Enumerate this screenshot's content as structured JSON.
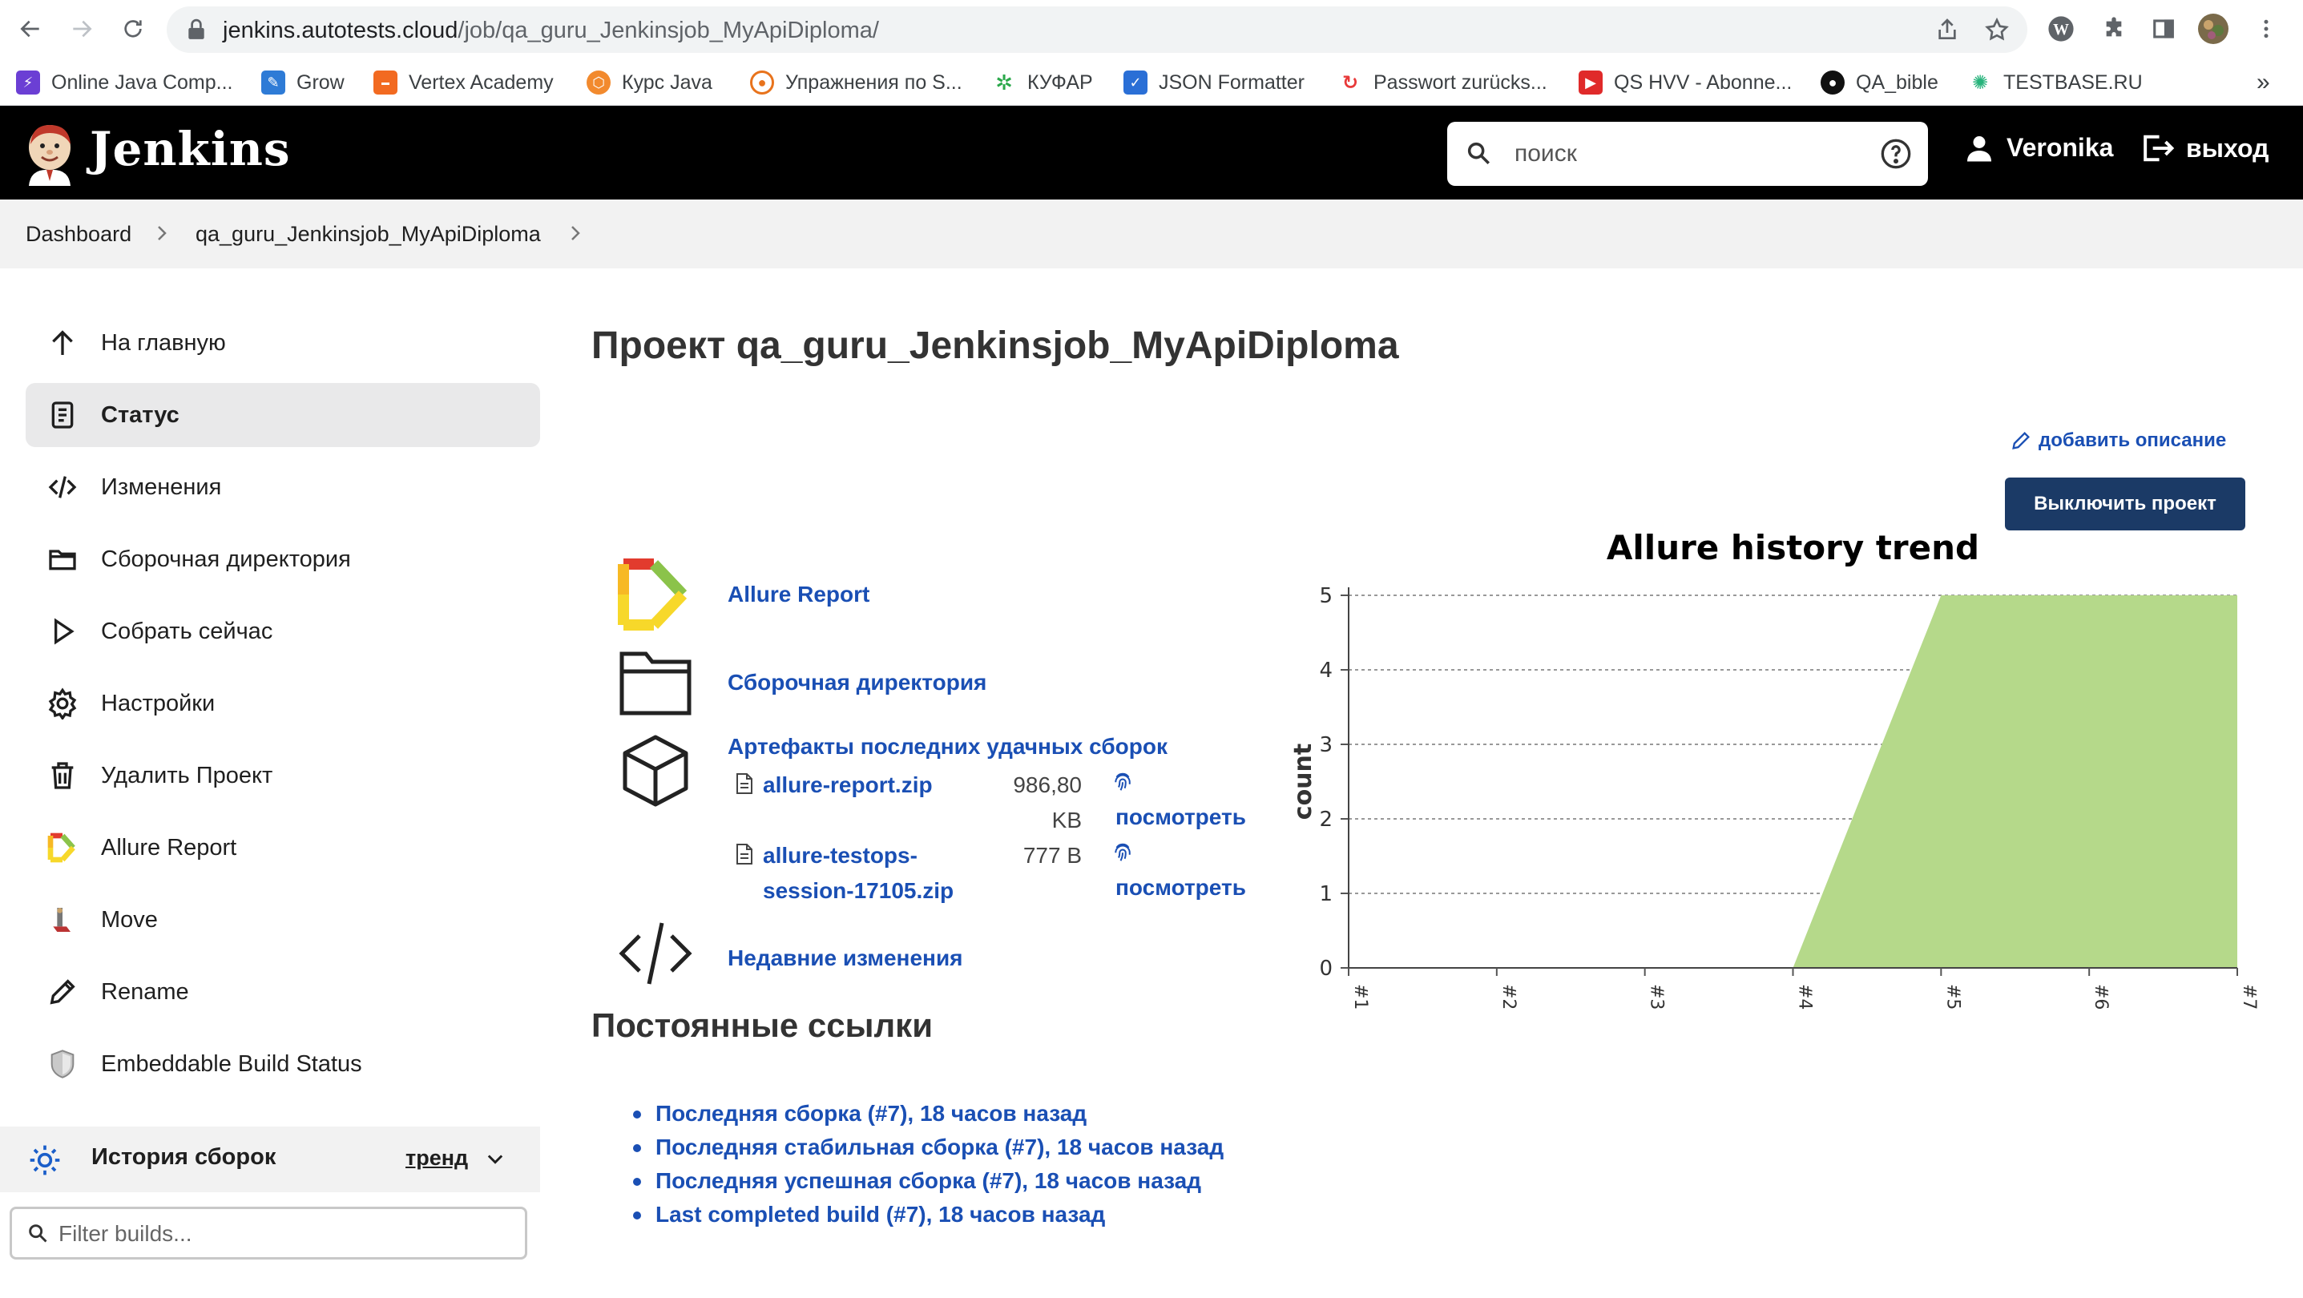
{
  "browser": {
    "url_host": "jenkins.autotests.cloud",
    "url_path": "/job/qa_guru_Jenkinsjob_MyApiDiploma/",
    "bookmarks": [
      {
        "label": "Online Java Comp...",
        "icon": "lightning-icon",
        "color": "#6b3fd4"
      },
      {
        "label": "Grow",
        "icon": "grow-icon",
        "color": "#2e7bd6"
      },
      {
        "label": "Vertex Academy",
        "icon": "vertex-icon",
        "color": "#f26a21"
      },
      {
        "label": "Курс Java",
        "icon": "hexagon-icon",
        "color": "#f28a2e"
      },
      {
        "label": "Упражнения по S...",
        "icon": "target-icon",
        "color": "#e8731c"
      },
      {
        "label": "КУФАР",
        "icon": "kufar-icon",
        "color": "#2aa84a"
      },
      {
        "label": "JSON Formatter",
        "icon": "check-icon",
        "color": "#2a6fd6"
      },
      {
        "label": "Passwort zurücks...",
        "icon": "refresh-icon",
        "color": "#e83a3a"
      },
      {
        "label": "QS HVV - Abonne...",
        "icon": "play-icon",
        "color": "#e02a2a"
      },
      {
        "label": "QA_bible",
        "icon": "github-icon",
        "color": "#111111"
      },
      {
        "label": "TESTBASE.RU",
        "icon": "bug-icon",
        "color": "#27b37b"
      }
    ],
    "more": "»"
  },
  "header": {
    "title": "Jenkins",
    "search_placeholder": "поиск",
    "user": "Veronika",
    "logout": "выход"
  },
  "breadcrumb": {
    "dashboard": "Dashboard",
    "job": "qa_guru_Jenkinsjob_MyApiDiploma"
  },
  "sidebar": {
    "items": [
      {
        "label": "На главную",
        "icon": "arrow-up-icon"
      },
      {
        "label": "Статус",
        "icon": "document-icon"
      },
      {
        "label": "Изменения",
        "icon": "code-icon"
      },
      {
        "label": "Сборочная директория",
        "icon": "folder-icon"
      },
      {
        "label": "Собрать сейчас",
        "icon": "play-icon"
      },
      {
        "label": "Настройки",
        "icon": "gear-icon"
      },
      {
        "label": "Удалить Проект",
        "icon": "trash-icon"
      },
      {
        "label": "Allure Report",
        "icon": "allure-icon"
      },
      {
        "label": "Move",
        "icon": "move-icon"
      },
      {
        "label": "Rename",
        "icon": "pencil-icon"
      },
      {
        "label": "Embeddable Build Status",
        "icon": "shield-icon"
      }
    ],
    "history_title": "История сборок",
    "trend_label": "тренд",
    "filter_placeholder": "Filter builds..."
  },
  "main": {
    "title": "Проект qa_guru_Jenkinsjob_MyApiDiploma",
    "add_description": "добавить описание",
    "disable_button": "Выключить проект",
    "links": {
      "allure": "Allure Report",
      "workspace": "Сборочная директория",
      "artifacts": "Артефакты последних удачных сборок",
      "changes": "Недавние изменения"
    },
    "artifacts": [
      {
        "name_line1": "allure-report.zip",
        "name_line2": "",
        "size_line1": "986,80",
        "size_line2": "KB",
        "view": "посмотреть"
      },
      {
        "name_line1": "allure-testops-",
        "name_line2": "session-17105.zip",
        "size_line1": "777 B",
        "size_line2": "",
        "view": "посмотреть"
      }
    ],
    "permalinks_title": "Постоянные ссылки",
    "permalinks": [
      "Последняя сборка (#7), 18 часов назад",
      "Последняя стабильная сборка (#7), 18 часов назад",
      "Последняя успешная сборка (#7), 18 часов назад",
      "Last completed build (#7), 18 часов назад"
    ]
  },
  "chart_data": {
    "type": "area",
    "title": "Allure history trend",
    "xlabel": "",
    "ylabel": "count",
    "categories": [
      "#1",
      "#2",
      "#3",
      "#4",
      "#5",
      "#6",
      "#7"
    ],
    "series": [
      {
        "values": [
          0,
          0,
          0,
          0,
          5,
          5,
          5
        ],
        "color": "#b5d98a"
      }
    ],
    "ylim": [
      0,
      5
    ],
    "yticks": [
      0,
      1,
      2,
      3,
      4,
      5
    ],
    "grid": true
  }
}
